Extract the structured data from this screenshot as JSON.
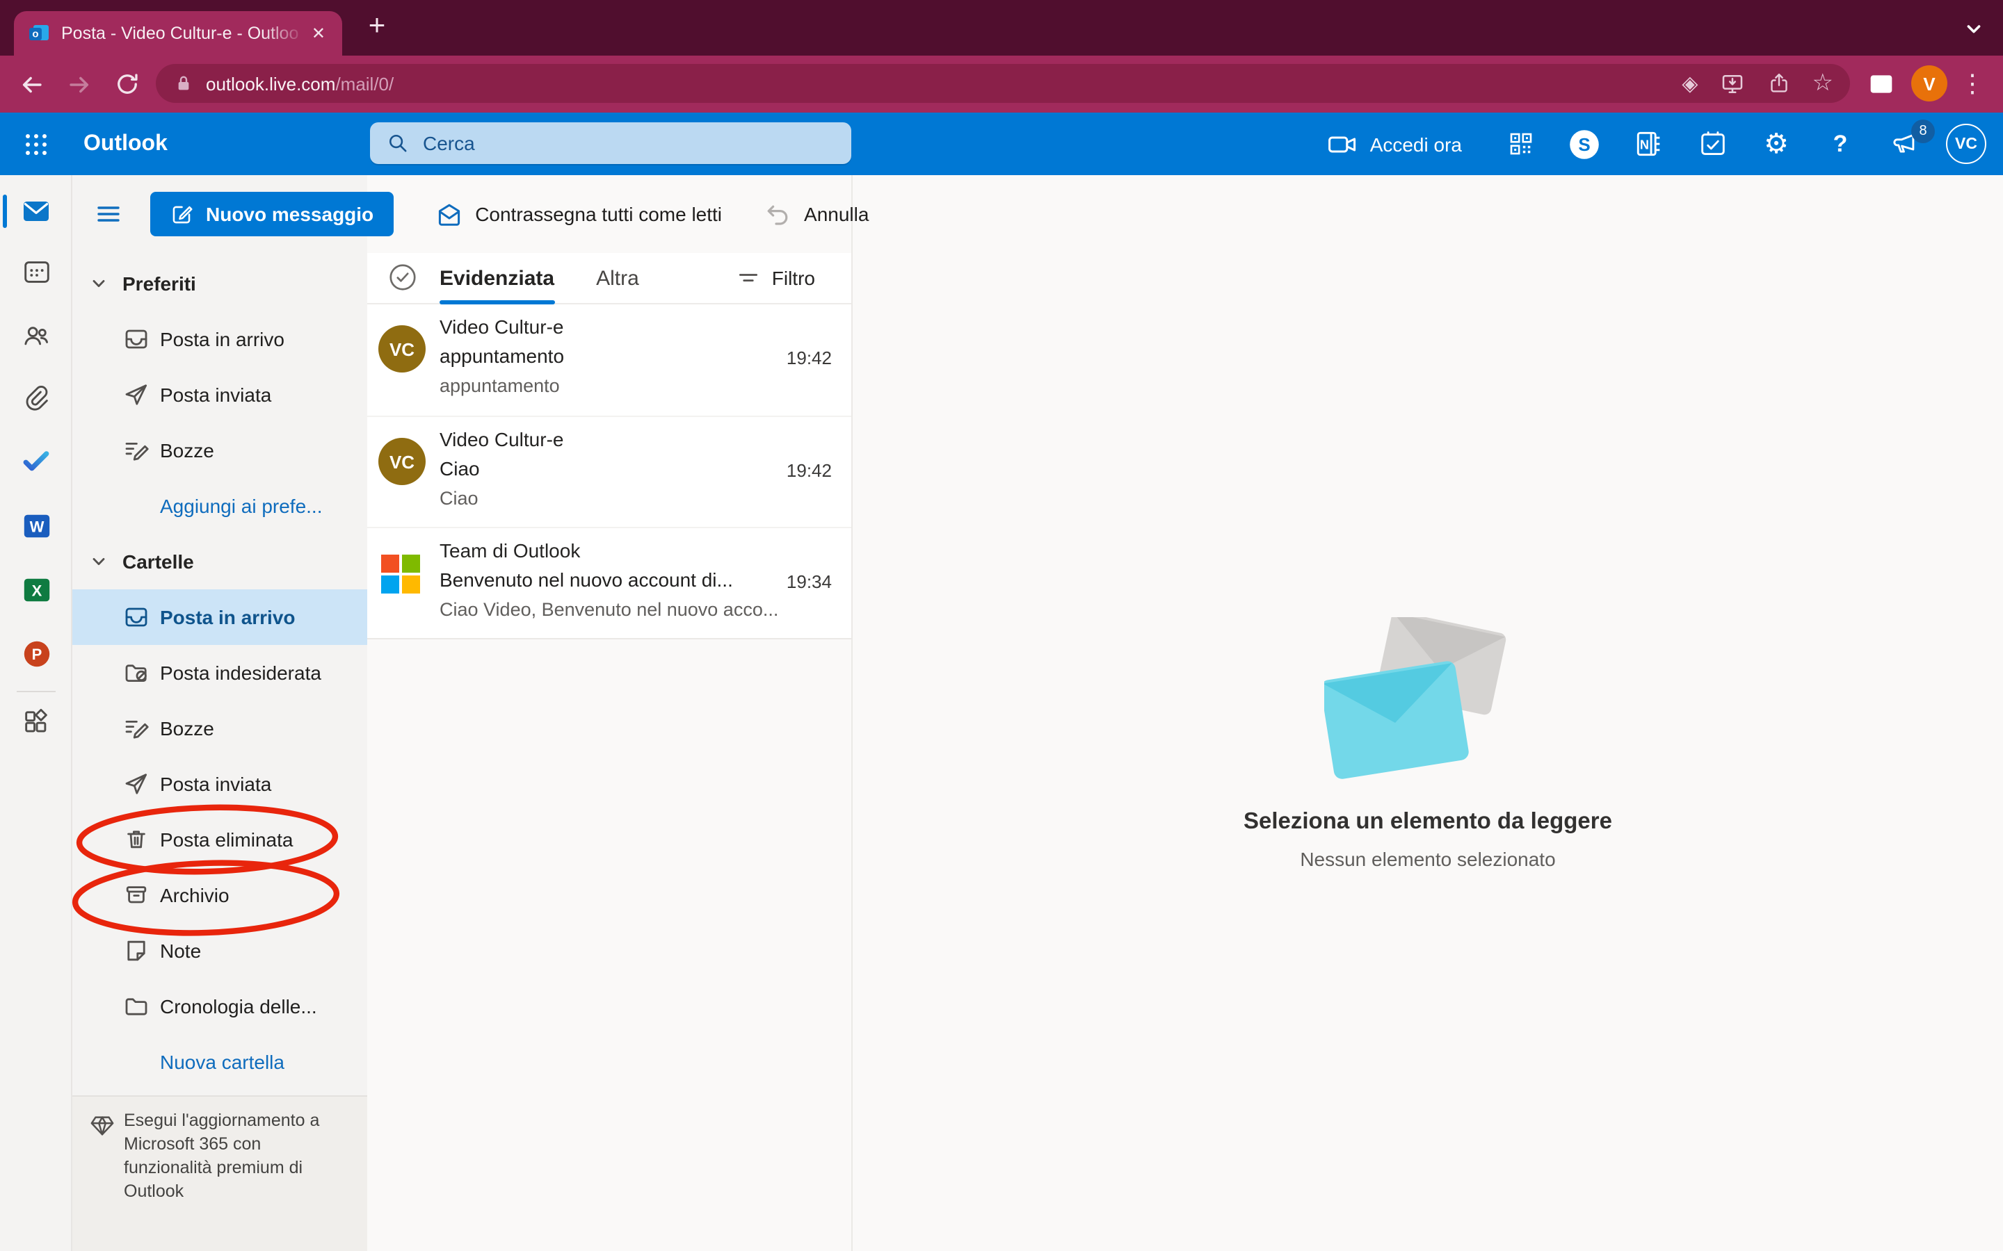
{
  "colors": {
    "accent_blue": "#0078D4",
    "tabstrip_bg": "#500E2E",
    "toolbar_bg": "#A12A5C",
    "omnibox_bg": "#8A2049",
    "search_bg": "#BBD9F2",
    "search_fg": "#17548F",
    "selected_folder_bg": "#CCE4F7",
    "selected_folder_fg": "#0F548C",
    "annotation_red": "#E8250C",
    "sender_avatar_gold": "#8F6C11",
    "browser_avatar_orange": "#E8710A",
    "badge_bg": "#115EA3"
  },
  "browser": {
    "tab_title": "Posta - Video Cultur-e - Outloo",
    "tab_close_glyph": "✕",
    "new_tab_glyph": "+",
    "url_domain": "outlook.live.com",
    "url_path": "/mail/0/",
    "extensions_glyph": "◈",
    "bookmark_glyph": "☆",
    "profile_initial": "V",
    "menu_glyph": "⋮"
  },
  "header": {
    "app_name": "Outlook",
    "search_placeholder": "Cerca",
    "signin_label": "Accedi ora",
    "badge_count": "8",
    "settings_glyph": "⚙",
    "help_glyph": "?",
    "avatar_initials": "VC"
  },
  "commandbar": {
    "new_message": "Nuovo messaggio",
    "mark_all_read": "Contrassegna tutti come letti",
    "undo": "Annulla"
  },
  "folderpane": {
    "favorites_header": "Preferiti",
    "favorites": [
      {
        "label": "Posta in arrivo",
        "icon": "inbox"
      },
      {
        "label": "Posta inviata",
        "icon": "send"
      },
      {
        "label": "Bozze",
        "icon": "drafts"
      }
    ],
    "add_favorite_link": "Aggiungi ai prefe...",
    "folders_header": "Cartelle",
    "folders": [
      {
        "label": "Posta in arrivo",
        "icon": "inbox",
        "selected": true
      },
      {
        "label": "Posta indesiderata",
        "icon": "junk"
      },
      {
        "label": "Bozze",
        "icon": "drafts"
      },
      {
        "label": "Posta inviata",
        "icon": "send"
      },
      {
        "label": "Posta eliminata",
        "icon": "trash",
        "annotated": true
      },
      {
        "label": "Archivio",
        "icon": "archive",
        "annotated": true
      },
      {
        "label": "Note",
        "icon": "note"
      },
      {
        "label": "Cronologia delle...",
        "icon": "folder"
      }
    ],
    "new_folder_link": "Nuova cartella",
    "upgrade_text": "Esegui l'aggiornamento a Microsoft 365 con funzionalità premium di Outlook"
  },
  "messagelist": {
    "tab_focused": "Evidenziata",
    "tab_other": "Altra",
    "filter_label": "Filtro",
    "messages": [
      {
        "avatar": "VC",
        "sender": "Video Cultur-e",
        "subject": "appuntamento",
        "preview": "appuntamento",
        "time": "19:42"
      },
      {
        "avatar": "VC",
        "sender": "Video Cultur-e",
        "subject": "Ciao",
        "preview": "Ciao",
        "time": "19:42"
      },
      {
        "avatar": "microsoft",
        "sender": "Team di Outlook",
        "subject": "Benvenuto nel nuovo account di...",
        "preview": "Ciao Video, Benvenuto nel nuovo acco...",
        "time": "19:34"
      }
    ]
  },
  "readingpane": {
    "title": "Seleziona un elemento da leggere",
    "subtitle": "Nessun elemento selezionato"
  }
}
